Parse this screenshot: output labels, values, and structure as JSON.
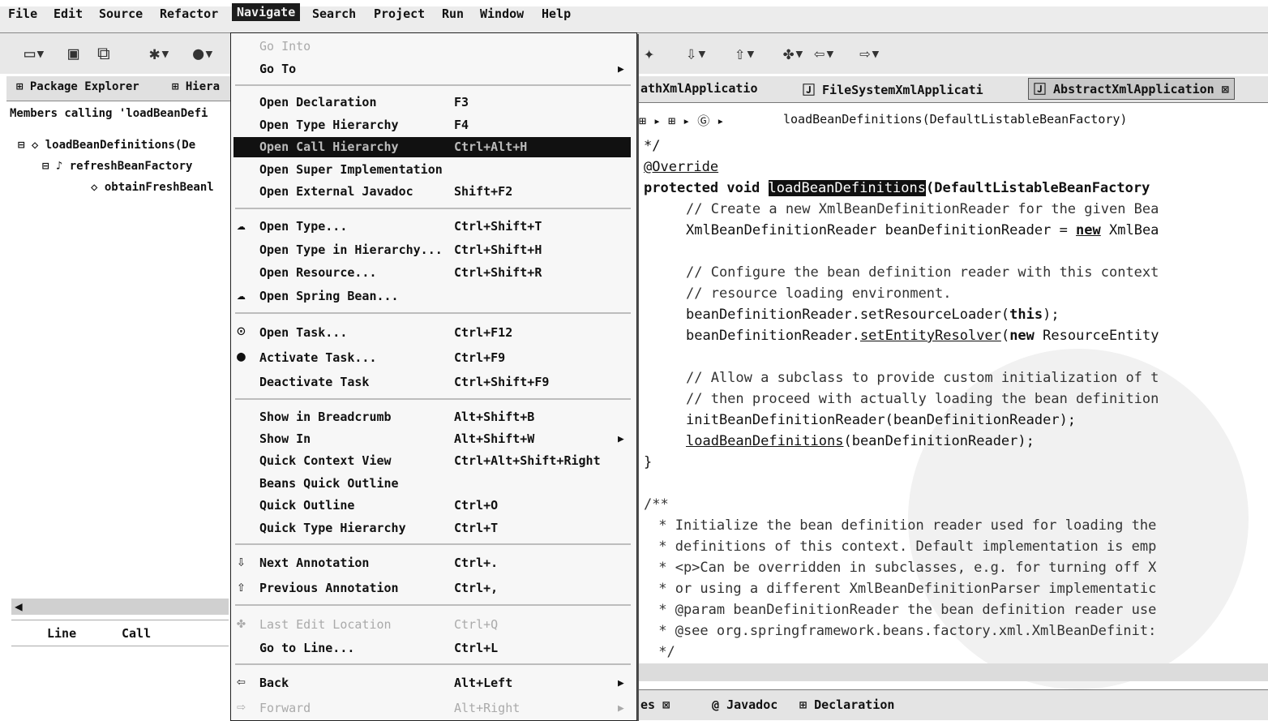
{
  "menubar": {
    "items": [
      "File",
      "Edit",
      "Source",
      "Refactor",
      "Navigate",
      "Search",
      "Project",
      "Run",
      "Window",
      "Help"
    ]
  },
  "left_panel": {
    "tabs": [
      "Package Explorer",
      "Hiera"
    ],
    "caption": "Members calling 'loadBeanDefi",
    "tree": [
      "loadBeanDefinitions(De",
      "refreshBeanFactory",
      "obtainFreshBeanl"
    ],
    "columns": [
      "Line",
      "Call"
    ]
  },
  "editor": {
    "tabs": [
      "athXmlApplicatio",
      "FileSystemXmlApplicati",
      "AbstractXmlApplication"
    ],
    "breadcrumb": "loadBeanDefinitions(DefaultListableBeanFactory)",
    "code": {
      "l1": "*/",
      "l2": "@Override",
      "l3_kw": "protected void ",
      "l3_sel": "loadBeanDefinitions",
      "l3_rest": "(DefaultListableBeanFactory",
      "l4": "// Create a new XmlBeanDefinitionReader for the given Bea",
      "l5a": "XmlBeanDefinitionReader beanDefinitionReader = ",
      "l5kw": "new",
      "l5b": " XmlBea",
      "l6": "// Configure the bean definition reader with this context",
      "l7": "// resource loading environment.",
      "l8a": "beanDefinitionReader.setResourceLoader(",
      "l8kw": "this",
      "l8b": ");",
      "l9a": "beanDefinitionReader.",
      "l9u": "setEntityResolver",
      "l9b": "(",
      "l9kw": "new",
      "l9c": " ResourceEntity",
      "l10": "// Allow a subclass to provide custom initialization of t",
      "l11": "// then proceed with actually loading the bean definition",
      "l12": "initBeanDefinitionReader(beanDefinitionReader);",
      "l13u": "loadBeanDefinitions",
      "l13b": "(beanDefinitionReader);",
      "l14": "}",
      "l15": "/**",
      "l16": " * Initialize the bean definition reader used for loading the",
      "l17": " * definitions of this context. Default implementation is emp",
      "l18": " * <p>Can be overridden in subclasses, e.g. for turning off X",
      "l19": " * or using a different XmlBeanDefinitionParser implementatic",
      "l20": " * @param beanDefinitionReader the bean definition reader use",
      "l21": " * @see org.springframework.beans.factory.xml.XmlBeanDefinit:",
      "l22": " */"
    },
    "bottom_tabs": [
      "es",
      "Javadoc",
      "Declaration"
    ]
  },
  "navigate_menu": {
    "go_into": "Go Into",
    "go_to": "Go To",
    "open_declaration": {
      "label": "Open Declaration",
      "shortcut": "F3"
    },
    "open_type_hierarchy": {
      "label": "Open Type Hierarchy",
      "shortcut": "F4"
    },
    "open_call_hierarchy": {
      "label": "Open Call Hierarchy",
      "shortcut": "Ctrl+Alt+H"
    },
    "open_super_impl": {
      "label": "Open Super Implementation"
    },
    "open_external_javadoc": {
      "label": "Open External Javadoc",
      "shortcut": "Shift+F2"
    },
    "open_type": {
      "label": "Open Type...",
      "shortcut": "Ctrl+Shift+T"
    },
    "open_type_in_hierarchy": {
      "label": "Open Type in Hierarchy...",
      "shortcut": "Ctrl+Shift+H"
    },
    "open_resource": {
      "label": "Open Resource...",
      "shortcut": "Ctrl+Shift+R"
    },
    "open_spring_bean": {
      "label": "Open Spring Bean..."
    },
    "open_task": {
      "label": "Open Task...",
      "shortcut": "Ctrl+F12"
    },
    "activate_task": {
      "label": "Activate Task...",
      "shortcut": "Ctrl+F9"
    },
    "deactivate_task": {
      "label": "Deactivate Task",
      "shortcut": "Ctrl+Shift+F9"
    },
    "show_in_breadcrumb": {
      "label": "Show in Breadcrumb",
      "shortcut": "Alt+Shift+B"
    },
    "show_in": {
      "label": "Show In",
      "shortcut": "Alt+Shift+W"
    },
    "quick_context_view": {
      "label": "Quick Context View",
      "shortcut": "Ctrl+Alt+Shift+Right"
    },
    "beans_quick_outline": {
      "label": "Beans Quick Outline"
    },
    "quick_outline": {
      "label": "Quick Outline",
      "shortcut": "Ctrl+O"
    },
    "quick_type_hierarchy": {
      "label": "Quick Type Hierarchy",
      "shortcut": "Ctrl+T"
    },
    "next_annotation": {
      "label": "Next Annotation",
      "shortcut": "Ctrl+."
    },
    "previous_annotation": {
      "label": "Previous Annotation",
      "shortcut": "Ctrl+,"
    },
    "last_edit_location": {
      "label": "Last Edit Location",
      "shortcut": "Ctrl+Q"
    },
    "go_to_line": {
      "label": "Go to Line...",
      "shortcut": "Ctrl+L"
    },
    "back": {
      "label": "Back",
      "shortcut": "Alt+Left"
    },
    "forward": {
      "label": "Forward",
      "shortcut": "Alt+Right"
    }
  }
}
